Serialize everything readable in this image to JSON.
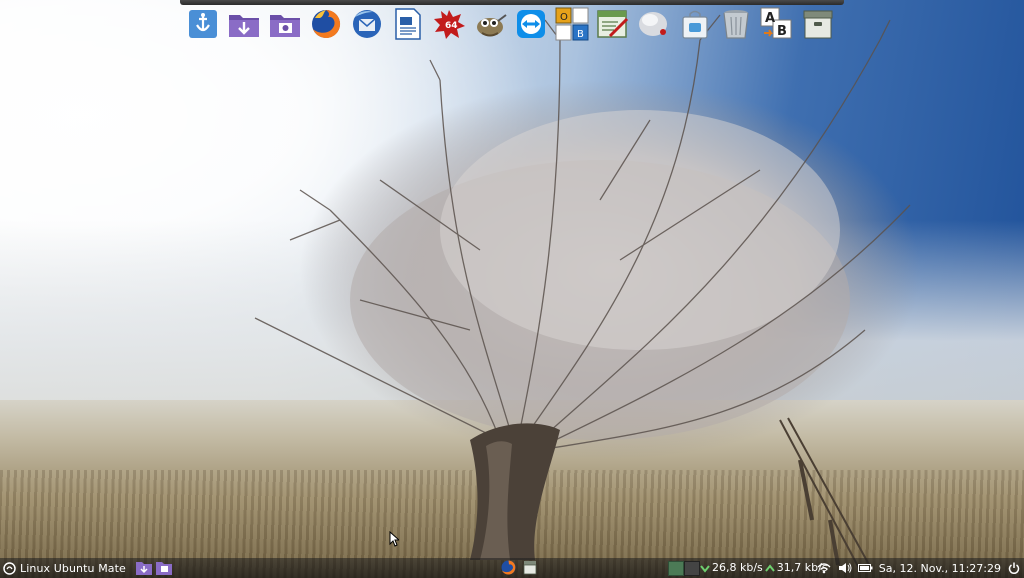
{
  "desktop": {
    "wallpaper": "frosted-tree-in-foggy-field"
  },
  "dock": {
    "launchers": [
      {
        "name": "anchor-app-icon",
        "tooltip": ""
      },
      {
        "name": "downloads-folder-icon",
        "tooltip": ""
      },
      {
        "name": "pictures-folder-icon",
        "tooltip": ""
      },
      {
        "name": "firefox-icon",
        "tooltip": ""
      },
      {
        "name": "thunderbird-icon",
        "tooltip": ""
      },
      {
        "name": "writer-document-icon",
        "tooltip": ""
      },
      {
        "name": "c64-emulator-icon",
        "tooltip": "64"
      },
      {
        "name": "gimp-icon",
        "tooltip": ""
      },
      {
        "name": "teamviewer-icon",
        "tooltip": ""
      },
      {
        "name": "office-suite-icon",
        "tooltip": ""
      },
      {
        "name": "editor-icon",
        "tooltip": ""
      },
      {
        "name": "disk-utility-icon",
        "tooltip": ""
      },
      {
        "name": "shopping-bag-icon",
        "tooltip": ""
      },
      {
        "name": "trash-icon",
        "tooltip": ""
      },
      {
        "name": "translator-icon",
        "tooltip": ""
      },
      {
        "name": "archive-manager-icon",
        "tooltip": ""
      }
    ],
    "office_letters": [
      "O",
      "B"
    ],
    "translator_letters": [
      "A",
      "B"
    ],
    "c64_text": "64"
  },
  "panel": {
    "menu_label": "Linux Ubuntu Mate",
    "download_speed": "26,8 kb/s",
    "upload_speed": "31,7 kb/s",
    "clock": "Sa, 12. Nov., 11:27:29",
    "accent": "#4c7a56"
  }
}
